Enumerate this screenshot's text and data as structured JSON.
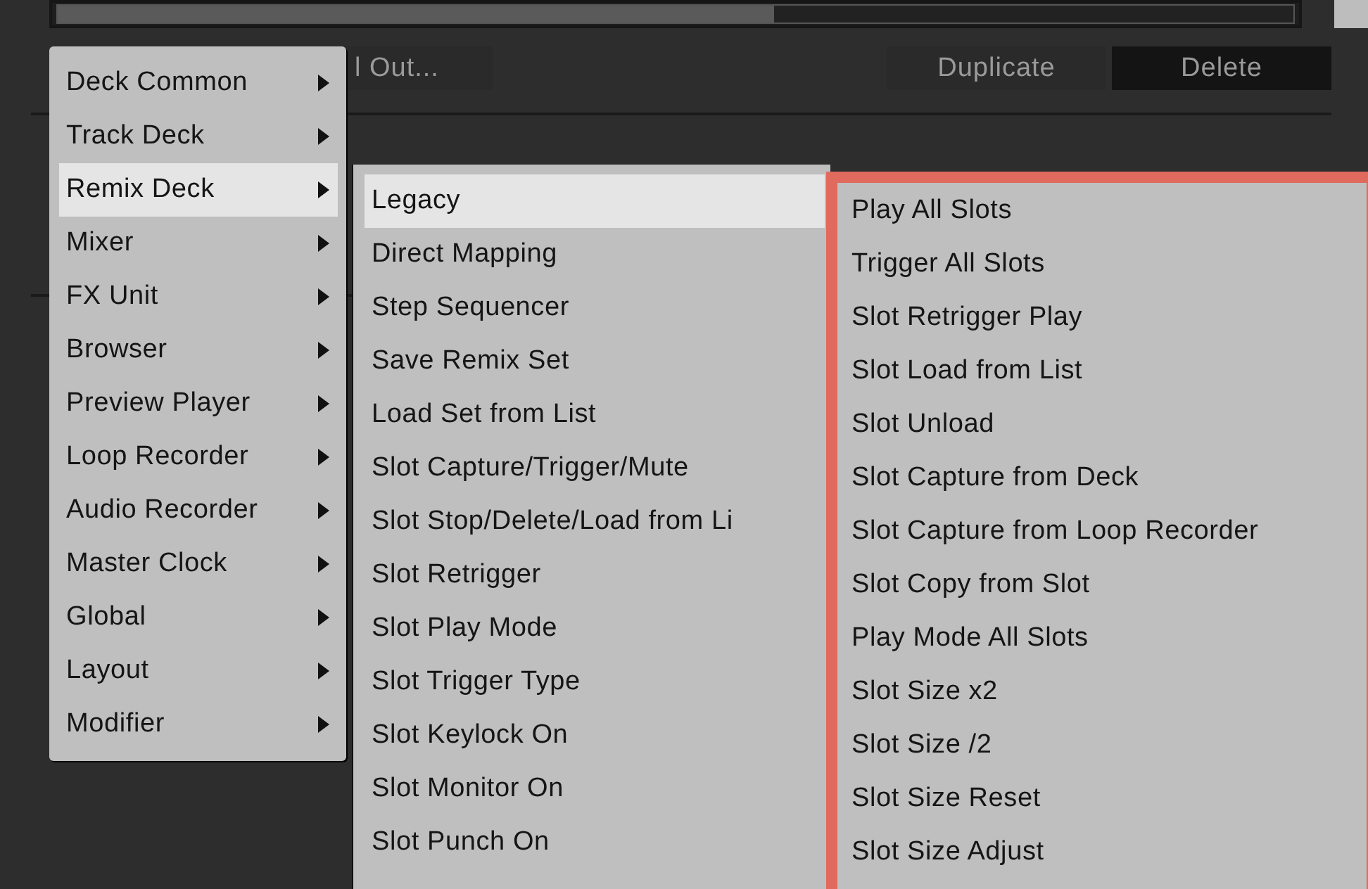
{
  "toolbar": {
    "buttons": [
      {
        "label": "l Out...",
        "selected": false
      },
      {
        "label": "Duplicate",
        "selected": false
      },
      {
        "label": "Delete",
        "selected": true
      }
    ]
  },
  "menus": [
    {
      "highlighted": false,
      "items": [
        {
          "label": "Deck Common",
          "selected": false,
          "submenu": true
        },
        {
          "label": "Track Deck",
          "selected": false,
          "submenu": true
        },
        {
          "label": "Remix Deck",
          "selected": true,
          "submenu": true
        },
        {
          "label": "Mixer",
          "selected": false,
          "submenu": true
        },
        {
          "label": "FX Unit",
          "selected": false,
          "submenu": true
        },
        {
          "label": "Browser",
          "selected": false,
          "submenu": true
        },
        {
          "label": "Preview Player",
          "selected": false,
          "submenu": true
        },
        {
          "label": "Loop Recorder",
          "selected": false,
          "submenu": true
        },
        {
          "label": "Audio Recorder",
          "selected": false,
          "submenu": true
        },
        {
          "label": "Master Clock",
          "selected": false,
          "submenu": true
        },
        {
          "label": "Global",
          "selected": false,
          "submenu": true
        },
        {
          "label": "Layout",
          "selected": false,
          "submenu": true
        },
        {
          "label": "Modifier",
          "selected": false,
          "submenu": true
        }
      ]
    },
    {
      "highlighted": false,
      "items": [
        {
          "label": "Legacy",
          "selected": true,
          "submenu": false
        },
        {
          "label": "Direct Mapping",
          "selected": false,
          "submenu": false
        },
        {
          "label": "Step Sequencer",
          "selected": false,
          "submenu": false
        },
        {
          "label": "Save Remix Set",
          "selected": false,
          "submenu": false
        },
        {
          "label": "Load Set from List",
          "selected": false,
          "submenu": false
        },
        {
          "label": "Slot Capture/Trigger/Mute",
          "selected": false,
          "submenu": false
        },
        {
          "label": "Slot Stop/Delete/Load from Li",
          "selected": false,
          "submenu": false
        },
        {
          "label": "Slot Retrigger",
          "selected": false,
          "submenu": false
        },
        {
          "label": "Slot Play Mode",
          "selected": false,
          "submenu": false
        },
        {
          "label": "Slot Trigger Type",
          "selected": false,
          "submenu": false
        },
        {
          "label": "Slot Keylock On",
          "selected": false,
          "submenu": false
        },
        {
          "label": "Slot Monitor On",
          "selected": false,
          "submenu": false
        },
        {
          "label": "Slot Punch On",
          "selected": false,
          "submenu": false
        }
      ]
    },
    {
      "highlighted": true,
      "items": [
        {
          "label": "Play All Slots",
          "selected": false,
          "submenu": false
        },
        {
          "label": "Trigger All Slots",
          "selected": false,
          "submenu": false
        },
        {
          "label": "Slot Retrigger Play",
          "selected": false,
          "submenu": false
        },
        {
          "label": "Slot Load from List",
          "selected": false,
          "submenu": false
        },
        {
          "label": "Slot Unload",
          "selected": false,
          "submenu": false
        },
        {
          "label": "Slot Capture from Deck",
          "selected": false,
          "submenu": false
        },
        {
          "label": "Slot Capture from Loop Recorder",
          "selected": false,
          "submenu": false
        },
        {
          "label": "Slot Copy from Slot",
          "selected": false,
          "submenu": false
        },
        {
          "label": "Play Mode All Slots",
          "selected": false,
          "submenu": false
        },
        {
          "label": "Slot Size x2",
          "selected": false,
          "submenu": false
        },
        {
          "label": "Slot Size /2",
          "selected": false,
          "submenu": false
        },
        {
          "label": "Slot Size Reset",
          "selected": false,
          "submenu": false
        },
        {
          "label": "Slot Size Adjust",
          "selected": false,
          "submenu": false
        }
      ]
    }
  ]
}
